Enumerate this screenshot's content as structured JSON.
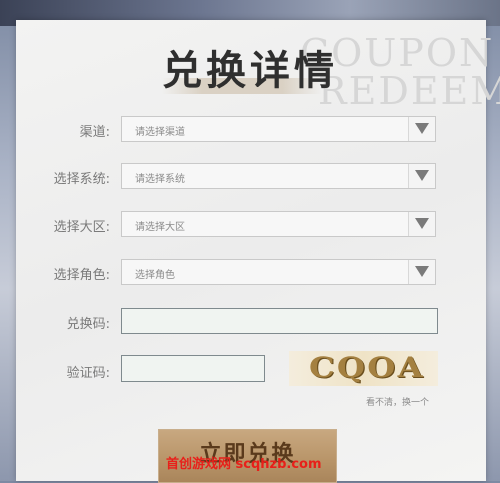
{
  "header": {
    "title": "兑换详情",
    "bg_line1": "COUPON",
    "bg_line2": "REDEEM"
  },
  "form": {
    "channel": {
      "label": "渠道:",
      "placeholder": "请选择渠道"
    },
    "system": {
      "label": "选择系统:",
      "placeholder": "请选择系统"
    },
    "region": {
      "label": "选择大区:",
      "placeholder": "请选择大区"
    },
    "role": {
      "label": "选择角色:",
      "placeholder": "选择角色"
    },
    "code": {
      "label": "兑换码:",
      "value": ""
    },
    "verify": {
      "label": "验证码:",
      "value": ""
    }
  },
  "captcha": {
    "text": "CQOA",
    "refresh_label": "看不清，换一个"
  },
  "submit_label": "立即兑换",
  "watermark": "首创游戏网 scqhzb.com",
  "colors": {
    "accent": "#b89468",
    "watermark": "#e8201a"
  }
}
